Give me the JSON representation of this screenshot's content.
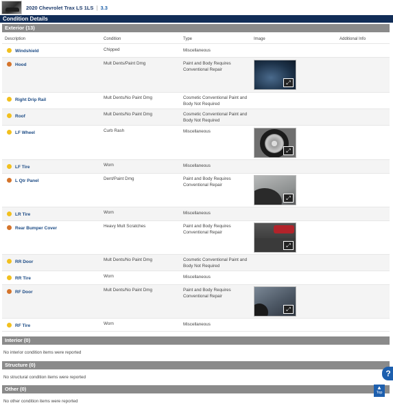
{
  "vehicle": {
    "title": "2020 Chevrolet Trax LS 1LS",
    "separator": "|",
    "grade": "3.3"
  },
  "page_title": "Condition Details",
  "exterior": {
    "section_title": "Exterior (13)",
    "columns": [
      "Description",
      "Condition",
      "Type",
      "Image",
      "Additional Info"
    ],
    "rows": [
      {
        "description": "Windshield",
        "condition": "Chipped",
        "type": "Miscellaneous",
        "severity": "yellow",
        "image": false
      },
      {
        "description": "Hood",
        "condition": "Mult Dents/Paint Dmg",
        "type": "Paint and Body Requires Conventional Repair",
        "severity": "orange",
        "image": true
      },
      {
        "description": "Right Drip Rail",
        "condition": "Mult Dents/No Paint Dmg",
        "type": "Cosmetic Conventional Paint and Body Not Required",
        "severity": "yellow",
        "image": false
      },
      {
        "description": "Roof",
        "condition": "Mult Dents/No Paint Dmg",
        "type": "Cosmetic Conventional Paint and Body Not Required",
        "severity": "yellow",
        "image": false
      },
      {
        "description": "LF Wheel",
        "condition": "Curb Rash",
        "type": "Miscellaneous",
        "severity": "yellow",
        "image": true
      },
      {
        "description": "LF Tire",
        "condition": "Worn",
        "type": "Miscellaneous",
        "severity": "yellow",
        "image": false
      },
      {
        "description": "L Qtr Panel",
        "condition": "Dent/Paint Dmg",
        "type": "Paint and Body Requires Conventional Repair",
        "severity": "orange",
        "image": true
      },
      {
        "description": "LR Tire",
        "condition": "Worn",
        "type": "Miscellaneous",
        "severity": "yellow",
        "image": false
      },
      {
        "description": "Rear Bumper Cover",
        "condition": "Heavy Mult Scratches",
        "type": "Paint and Body Requires Conventional Repair",
        "severity": "orange",
        "image": true
      },
      {
        "description": "RR Door",
        "condition": "Mult Dents/No Paint Dmg",
        "type": "Cosmetic Conventional Paint and Body Not Required",
        "severity": "yellow",
        "image": false
      },
      {
        "description": "RR Tire",
        "condition": "Worn",
        "type": "Miscellaneous",
        "severity": "yellow",
        "image": false
      },
      {
        "description": "RF Door",
        "condition": "Mult Dents/No Paint Dmg",
        "type": "Paint and Body Requires Conventional Repair",
        "severity": "orange",
        "image": true
      },
      {
        "description": "RF Tire",
        "condition": "Worn",
        "type": "Miscellaneous",
        "severity": "yellow",
        "image": false
      }
    ]
  },
  "interior": {
    "section_title": "Interior (0)",
    "note": "No interior condition items were reported"
  },
  "structure": {
    "section_title": "Structure (0)",
    "note": "No structural condition items were reported"
  },
  "other": {
    "section_title": "Other (0)",
    "note": "No other condition items were reported"
  },
  "help_button": {
    "label": "?"
  },
  "top_button": {
    "label": "Top"
  },
  "colors": {
    "header": "#112d57",
    "section": "#8a8a8a",
    "link": "#1b4a84",
    "yellow": "#f2c01e",
    "orange": "#d5742b"
  }
}
